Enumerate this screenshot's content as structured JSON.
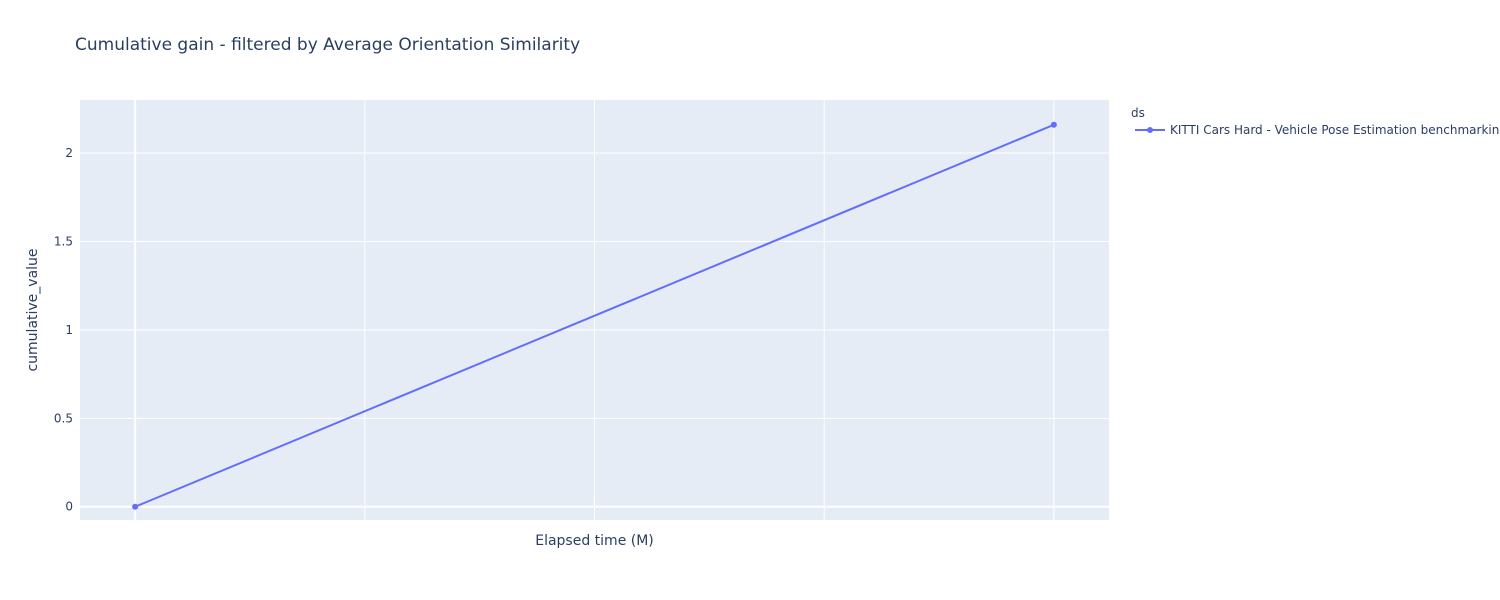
{
  "chart_data": {
    "type": "line",
    "title": "Cumulative gain - filtered by Average Orientation Similarity",
    "xlabel": "Elapsed time (M)",
    "ylabel": "cumulative_value",
    "x_tick_labels_shown": false,
    "yticks": [
      0,
      0.5,
      1,
      1.5,
      2
    ],
    "ytick_labels": [
      "0",
      "0.5",
      "1",
      "1.5",
      "2"
    ],
    "ylim": [
      -0.075,
      2.3
    ],
    "xlim": [
      -0.24,
      4.24
    ],
    "grid": true,
    "legend_title": "ds",
    "legend_position": "top-right outside",
    "series": [
      {
        "name": "KITTI Cars Hard - Vehicle Pose Estimation benchmarking",
        "color": "#636efa",
        "mode": "lines+markers",
        "x": [
          0,
          4
        ],
        "y": [
          0,
          2.16
        ]
      }
    ]
  },
  "colors": {
    "plot_background": "#e5ecf6",
    "grid": "#ffffff",
    "text": "#2a3f5f"
  }
}
